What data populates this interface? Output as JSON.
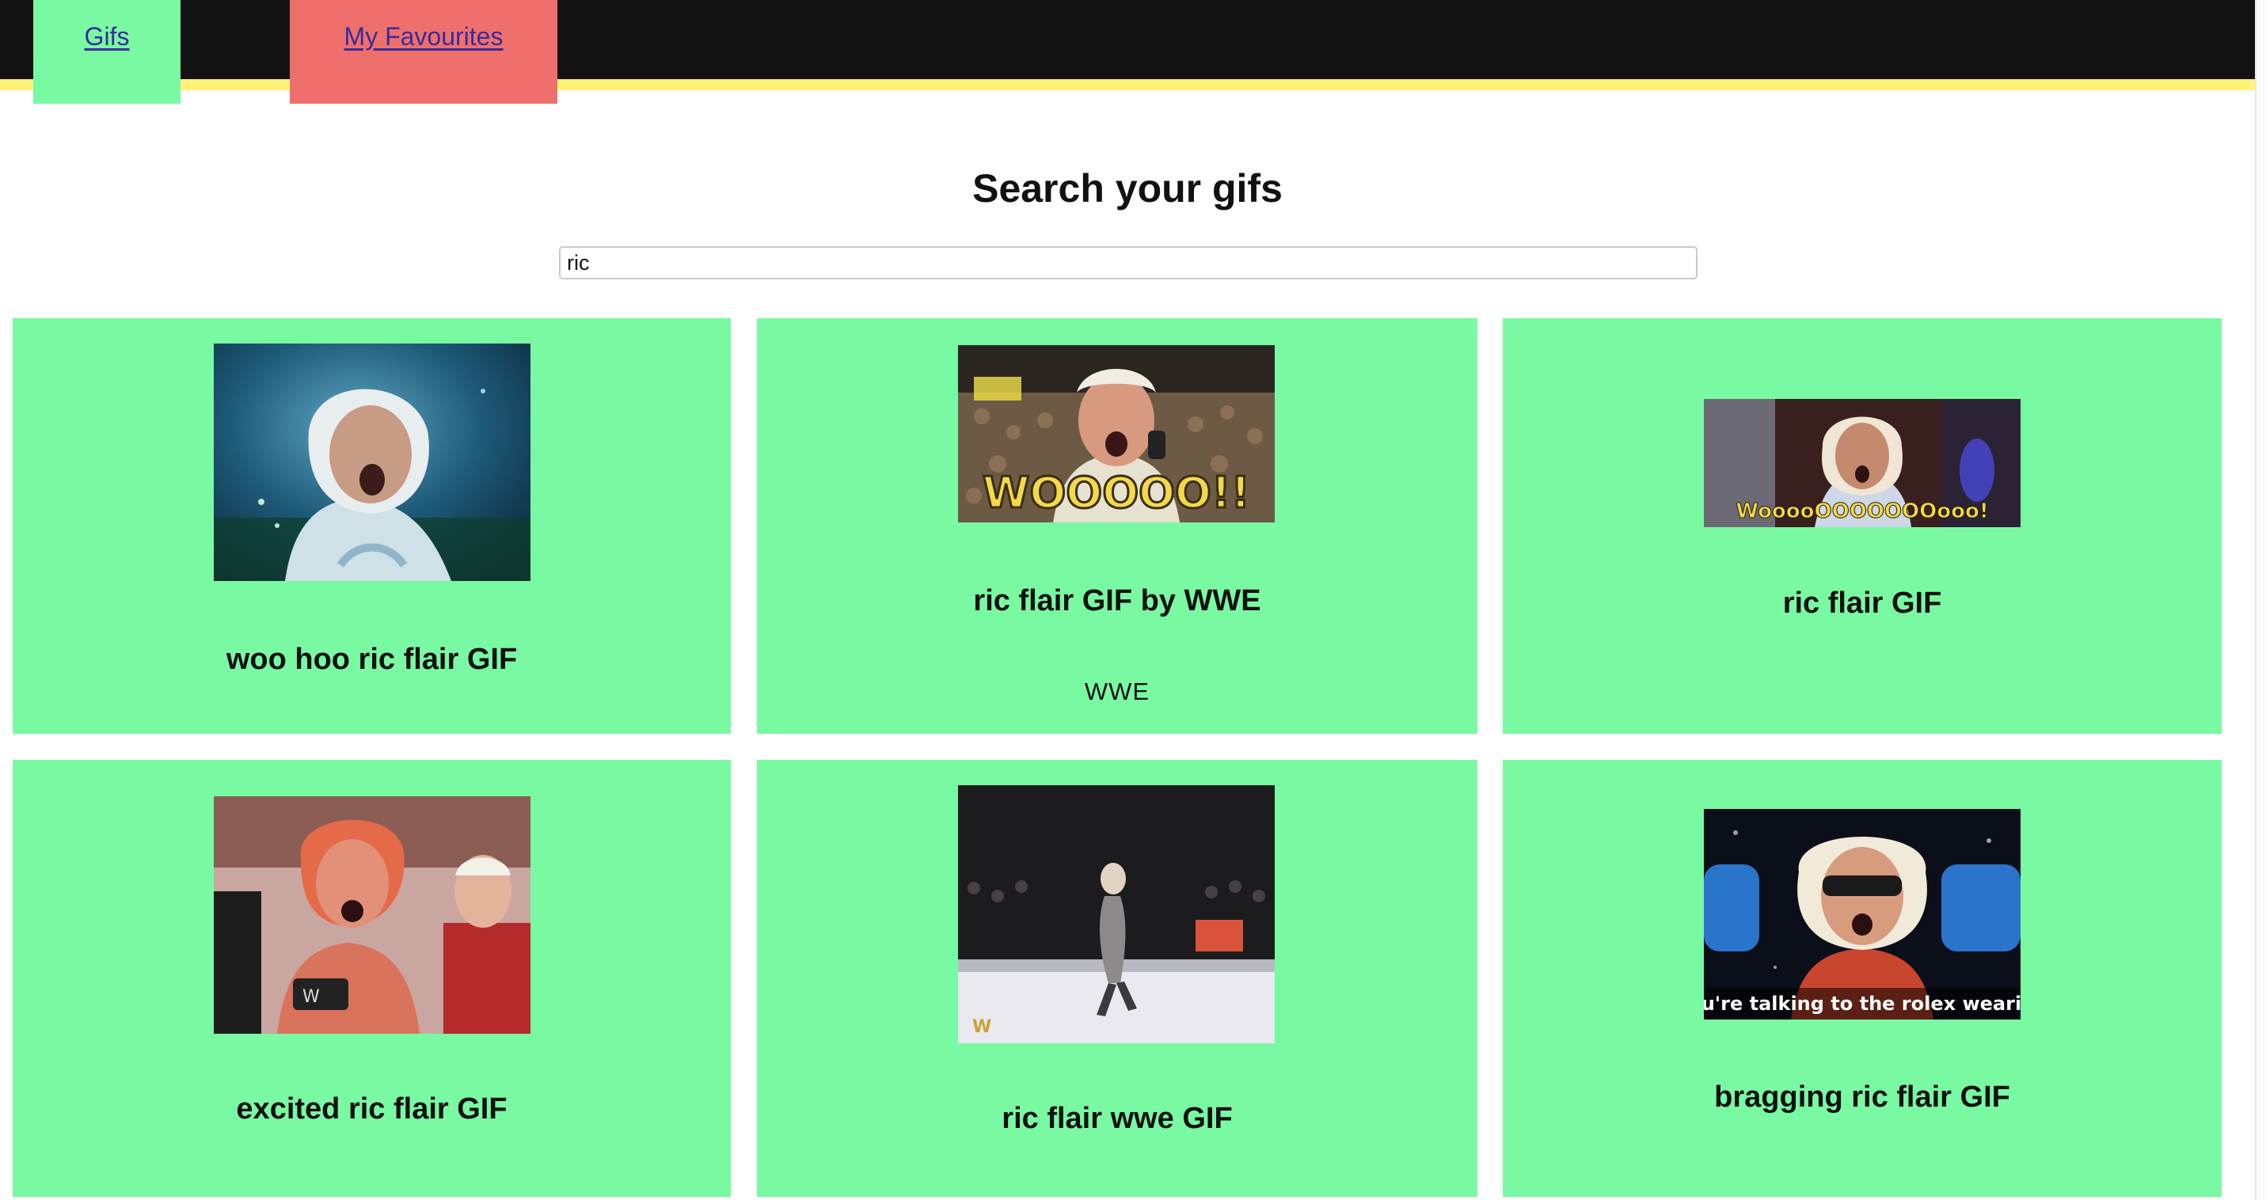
{
  "colors": {
    "header_bg": "#131313",
    "header_stripe": "#fff176",
    "gifs_tab_bg": "#79f9a2",
    "favs_tab_bg": "#ef6f6c",
    "card_bg": "#79f9a2",
    "link": "#3a2b9c"
  },
  "nav": {
    "gifs_label": "Gifs",
    "favourites_label": "My Favourites"
  },
  "heading": "Search your gifs",
  "search": {
    "value": "ric"
  },
  "results": [
    {
      "title": "woo hoo ric flair GIF",
      "username": ""
    },
    {
      "title": "ric flair GIF by WWE",
      "username": "WWE",
      "overlay_text": "WOOOOO!!"
    },
    {
      "title": "ric flair GIF",
      "username": "",
      "overlay_text": "WooooOOOOOOOooo!"
    },
    {
      "title": "excited ric flair GIF",
      "username": ""
    },
    {
      "title": "ric flair wwe GIF",
      "username": ""
    },
    {
      "title": "bragging ric flair GIF",
      "username": "",
      "overlay_text": "you're talking to the rolex wearing"
    }
  ]
}
